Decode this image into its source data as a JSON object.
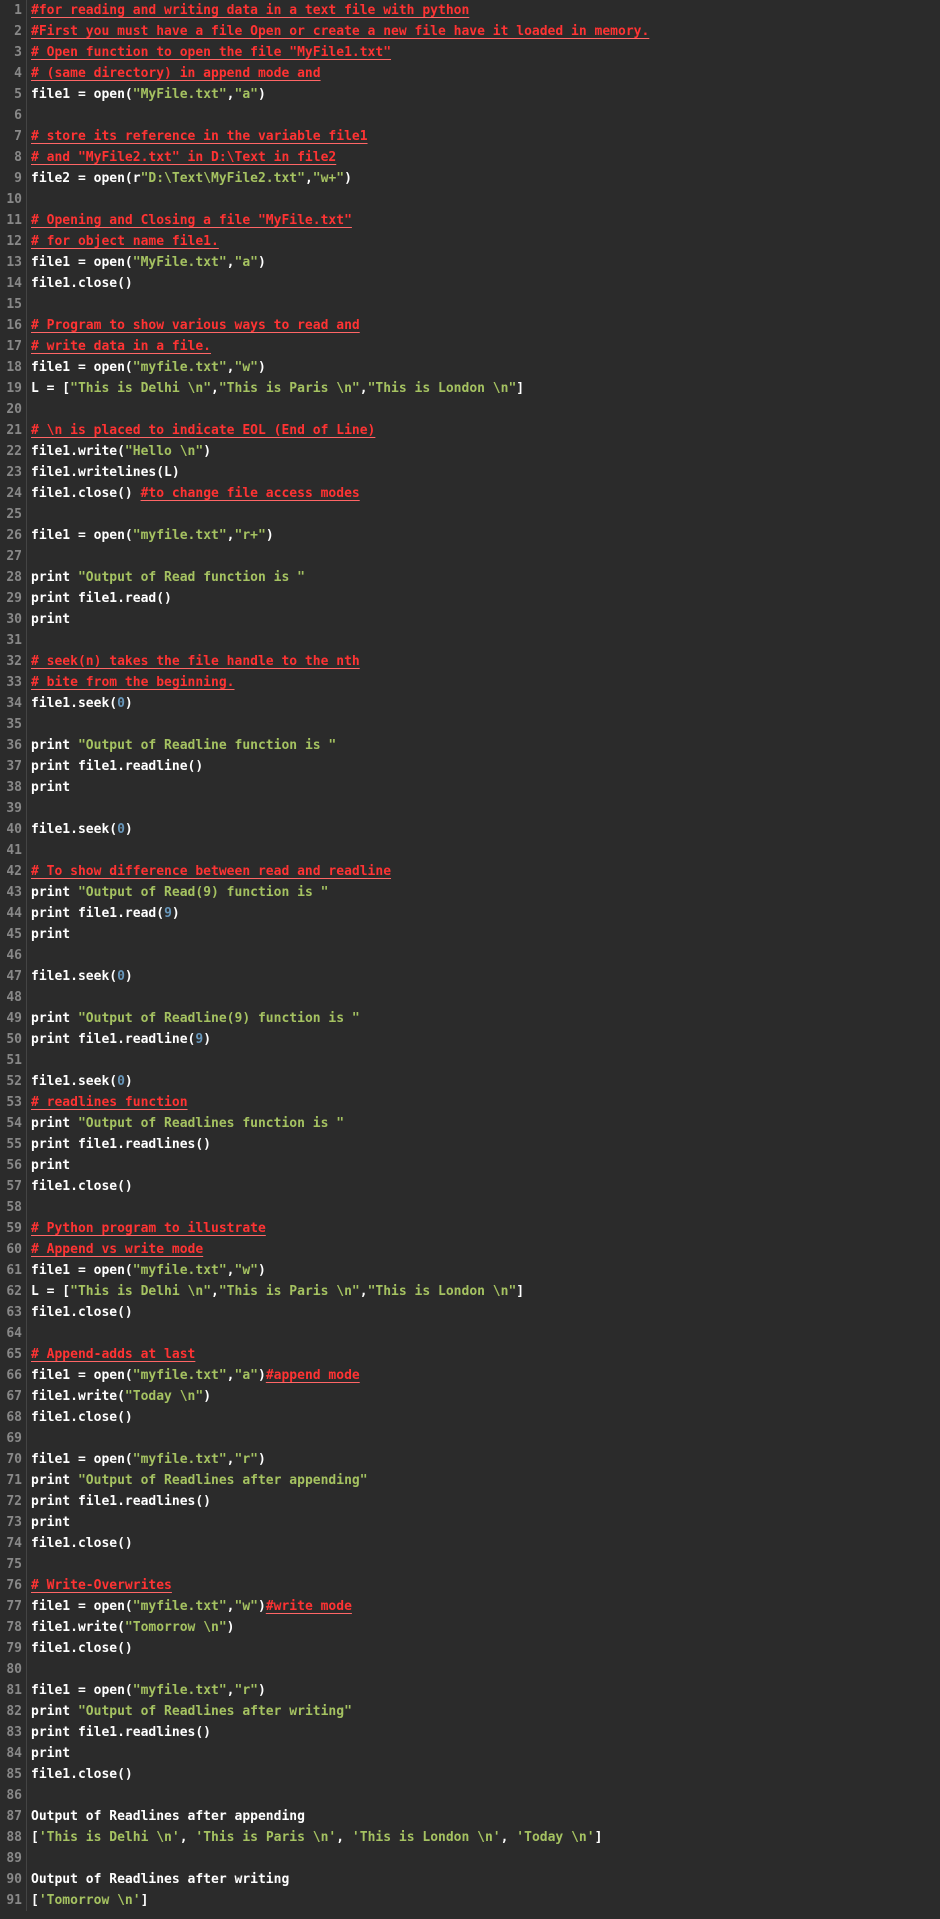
{
  "lines": [
    [
      {
        "t": "#for reading and writing data in a text file with python",
        "cls": "c u"
      }
    ],
    [
      {
        "t": "#First you must have a file Open or create a new file have it loaded in memory.",
        "cls": "c u"
      }
    ],
    [
      {
        "t": "# Open function to open the file \"MyFile1.txt\"",
        "cls": "c u"
      }
    ],
    [
      {
        "t": "# (same directory) in append mode and",
        "cls": "c u"
      }
    ],
    [
      {
        "t": "file1 = open(",
        "cls": "fn"
      },
      {
        "t": "\"MyFile.txt\"",
        "cls": "s"
      },
      {
        "t": ",",
        "cls": "fn"
      },
      {
        "t": "\"a\"",
        "cls": "s"
      },
      {
        "t": ")",
        "cls": "fn"
      }
    ],
    [],
    [
      {
        "t": "# store its reference in the variable file1",
        "cls": "c u"
      }
    ],
    [
      {
        "t": "# and \"MyFile2.txt\" in D:\\Text in file2",
        "cls": "c u"
      }
    ],
    [
      {
        "t": "file2 = open(r",
        "cls": "fn"
      },
      {
        "t": "\"D:\\Text\\MyFile2.txt\"",
        "cls": "s"
      },
      {
        "t": ",",
        "cls": "fn"
      },
      {
        "t": "\"w+\"",
        "cls": "s"
      },
      {
        "t": ")",
        "cls": "fn"
      }
    ],
    [],
    [
      {
        "t": "# Opening and Closing a file \"MyFile.txt\"",
        "cls": "c u"
      }
    ],
    [
      {
        "t": "# for object name file1.",
        "cls": "c u"
      }
    ],
    [
      {
        "t": "file1 = open(",
        "cls": "fn"
      },
      {
        "t": "\"MyFile.txt\"",
        "cls": "s"
      },
      {
        "t": ",",
        "cls": "fn"
      },
      {
        "t": "\"a\"",
        "cls": "s"
      },
      {
        "t": ")",
        "cls": "fn"
      }
    ],
    [
      {
        "t": "file1.close()",
        "cls": "fn"
      }
    ],
    [],
    [
      {
        "t": "# Program to show various ways to read and",
        "cls": "c u"
      }
    ],
    [
      {
        "t": "# write data in a file.",
        "cls": "c u"
      }
    ],
    [
      {
        "t": "file1 = open(",
        "cls": "fn"
      },
      {
        "t": "\"myfile.txt\"",
        "cls": "s"
      },
      {
        "t": ",",
        "cls": "fn"
      },
      {
        "t": "\"w\"",
        "cls": "s"
      },
      {
        "t": ")",
        "cls": "fn"
      }
    ],
    [
      {
        "t": "L = [",
        "cls": "fn"
      },
      {
        "t": "\"This is Delhi \\n\"",
        "cls": "s"
      },
      {
        "t": ",",
        "cls": "fn"
      },
      {
        "t": "\"This is Paris \\n\"",
        "cls": "s"
      },
      {
        "t": ",",
        "cls": "fn"
      },
      {
        "t": "\"This is London \\n\"",
        "cls": "s"
      },
      {
        "t": "]",
        "cls": "fn"
      }
    ],
    [],
    [
      {
        "t": "# \\n is placed to indicate EOL (End of Line)",
        "cls": "c u"
      }
    ],
    [
      {
        "t": "file1.write(",
        "cls": "fn"
      },
      {
        "t": "\"Hello \\n\"",
        "cls": "s"
      },
      {
        "t": ")",
        "cls": "fn"
      }
    ],
    [
      {
        "t": "file1.writelines(L)",
        "cls": "fn"
      }
    ],
    [
      {
        "t": "file1.close() ",
        "cls": "fn"
      },
      {
        "t": "#to change file access modes",
        "cls": "c u"
      }
    ],
    [],
    [
      {
        "t": "file1 = open(",
        "cls": "fn"
      },
      {
        "t": "\"myfile.txt\"",
        "cls": "s"
      },
      {
        "t": ",",
        "cls": "fn"
      },
      {
        "t": "\"r+\"",
        "cls": "s"
      },
      {
        "t": ")",
        "cls": "fn"
      }
    ],
    [],
    [
      {
        "t": "print ",
        "cls": "fn"
      },
      {
        "t": "\"Output of Read function is \"",
        "cls": "s"
      }
    ],
    [
      {
        "t": "print file1.read()",
        "cls": "fn"
      }
    ],
    [
      {
        "t": "print",
        "cls": "fn"
      }
    ],
    [],
    [
      {
        "t": "# seek(n) takes the file handle to the nth",
        "cls": "c u"
      }
    ],
    [
      {
        "t": "# bite from the beginning.",
        "cls": "c u"
      }
    ],
    [
      {
        "t": "file1.seek(",
        "cls": "fn"
      },
      {
        "t": "0",
        "cls": "n"
      },
      {
        "t": ")",
        "cls": "fn"
      }
    ],
    [],
    [
      {
        "t": "print ",
        "cls": "fn"
      },
      {
        "t": "\"Output of Readline function is \"",
        "cls": "s"
      }
    ],
    [
      {
        "t": "print file1.readline()",
        "cls": "fn"
      }
    ],
    [
      {
        "t": "print",
        "cls": "fn"
      }
    ],
    [],
    [
      {
        "t": "file1.seek(",
        "cls": "fn"
      },
      {
        "t": "0",
        "cls": "n"
      },
      {
        "t": ")",
        "cls": "fn"
      }
    ],
    [],
    [
      {
        "t": "# To show difference between read and readline",
        "cls": "c u"
      }
    ],
    [
      {
        "t": "print ",
        "cls": "fn"
      },
      {
        "t": "\"Output of Read(9) function is \"",
        "cls": "s"
      }
    ],
    [
      {
        "t": "print file1.read(",
        "cls": "fn"
      },
      {
        "t": "9",
        "cls": "n"
      },
      {
        "t": ")",
        "cls": "fn"
      }
    ],
    [
      {
        "t": "print",
        "cls": "fn"
      }
    ],
    [],
    [
      {
        "t": "file1.seek(",
        "cls": "fn"
      },
      {
        "t": "0",
        "cls": "n"
      },
      {
        "t": ")",
        "cls": "fn"
      }
    ],
    [],
    [
      {
        "t": "print ",
        "cls": "fn"
      },
      {
        "t": "\"Output of Readline(9) function is \"",
        "cls": "s"
      }
    ],
    [
      {
        "t": "print file1.readline(",
        "cls": "fn"
      },
      {
        "t": "9",
        "cls": "n"
      },
      {
        "t": ")",
        "cls": "fn"
      }
    ],
    [],
    [
      {
        "t": "file1.seek(",
        "cls": "fn"
      },
      {
        "t": "0",
        "cls": "n"
      },
      {
        "t": ")",
        "cls": "fn"
      }
    ],
    [
      {
        "t": "# readlines function",
        "cls": "c u"
      }
    ],
    [
      {
        "t": "print ",
        "cls": "fn"
      },
      {
        "t": "\"Output of Readlines function is \"",
        "cls": "s"
      }
    ],
    [
      {
        "t": "print file1.readlines()",
        "cls": "fn"
      }
    ],
    [
      {
        "t": "print",
        "cls": "fn"
      }
    ],
    [
      {
        "t": "file1.close()",
        "cls": "fn"
      }
    ],
    [],
    [
      {
        "t": "# Python program to illustrate",
        "cls": "c u"
      }
    ],
    [
      {
        "t": "# Append vs write mode",
        "cls": "c u"
      }
    ],
    [
      {
        "t": "file1 = open(",
        "cls": "fn"
      },
      {
        "t": "\"myfile.txt\"",
        "cls": "s"
      },
      {
        "t": ",",
        "cls": "fn"
      },
      {
        "t": "\"w\"",
        "cls": "s"
      },
      {
        "t": ")",
        "cls": "fn"
      }
    ],
    [
      {
        "t": "L = [",
        "cls": "fn"
      },
      {
        "t": "\"This is Delhi \\n\"",
        "cls": "s"
      },
      {
        "t": ",",
        "cls": "fn"
      },
      {
        "t": "\"This is Paris \\n\"",
        "cls": "s"
      },
      {
        "t": ",",
        "cls": "fn"
      },
      {
        "t": "\"This is London \\n\"",
        "cls": "s"
      },
      {
        "t": "]",
        "cls": "fn"
      }
    ],
    [
      {
        "t": "file1.close()",
        "cls": "fn"
      }
    ],
    [],
    [
      {
        "t": "# Append-adds at last",
        "cls": "c u"
      }
    ],
    [
      {
        "t": "file1 = open(",
        "cls": "fn"
      },
      {
        "t": "\"myfile.txt\"",
        "cls": "s"
      },
      {
        "t": ",",
        "cls": "fn"
      },
      {
        "t": "\"a\"",
        "cls": "s"
      },
      {
        "t": ")",
        "cls": "fn"
      },
      {
        "t": "#append mode",
        "cls": "c u"
      }
    ],
    [
      {
        "t": "file1.write(",
        "cls": "fn"
      },
      {
        "t": "\"Today \\n\"",
        "cls": "s"
      },
      {
        "t": ")",
        "cls": "fn"
      }
    ],
    [
      {
        "t": "file1.close()",
        "cls": "fn"
      }
    ],
    [],
    [
      {
        "t": "file1 = open(",
        "cls": "fn"
      },
      {
        "t": "\"myfile.txt\"",
        "cls": "s"
      },
      {
        "t": ",",
        "cls": "fn"
      },
      {
        "t": "\"r\"",
        "cls": "s"
      },
      {
        "t": ")",
        "cls": "fn"
      }
    ],
    [
      {
        "t": "print ",
        "cls": "fn"
      },
      {
        "t": "\"Output of Readlines after appending\"",
        "cls": "s"
      }
    ],
    [
      {
        "t": "print file1.readlines()",
        "cls": "fn"
      }
    ],
    [
      {
        "t": "print",
        "cls": "fn"
      }
    ],
    [
      {
        "t": "file1.close()",
        "cls": "fn"
      }
    ],
    [],
    [
      {
        "t": "# Write-Overwrites",
        "cls": "c u"
      }
    ],
    [
      {
        "t": "file1 = open(",
        "cls": "fn"
      },
      {
        "t": "\"myfile.txt\"",
        "cls": "s"
      },
      {
        "t": ",",
        "cls": "fn"
      },
      {
        "t": "\"w\"",
        "cls": "s"
      },
      {
        "t": ")",
        "cls": "fn"
      },
      {
        "t": "#write mode",
        "cls": "c u"
      }
    ],
    [
      {
        "t": "file1.write(",
        "cls": "fn"
      },
      {
        "t": "\"Tomorrow \\n\"",
        "cls": "s"
      },
      {
        "t": ")",
        "cls": "fn"
      }
    ],
    [
      {
        "t": "file1.close()",
        "cls": "fn"
      }
    ],
    [],
    [
      {
        "t": "file1 = open(",
        "cls": "fn"
      },
      {
        "t": "\"myfile.txt\"",
        "cls": "s"
      },
      {
        "t": ",",
        "cls": "fn"
      },
      {
        "t": "\"r\"",
        "cls": "s"
      },
      {
        "t": ")",
        "cls": "fn"
      }
    ],
    [
      {
        "t": "print ",
        "cls": "fn"
      },
      {
        "t": "\"Output of Readlines after writing\"",
        "cls": "s"
      }
    ],
    [
      {
        "t": "print file1.readlines()",
        "cls": "fn"
      }
    ],
    [
      {
        "t": "print",
        "cls": "fn"
      }
    ],
    [
      {
        "t": "file1.close()",
        "cls": "fn"
      }
    ],
    [],
    [
      {
        "t": "Output of Readlines after appending",
        "cls": "fn"
      }
    ],
    [
      {
        "t": "[",
        "cls": "fn"
      },
      {
        "t": "'This is Delhi \\n'",
        "cls": "s"
      },
      {
        "t": ", ",
        "cls": "fn"
      },
      {
        "t": "'This is Paris \\n'",
        "cls": "s"
      },
      {
        "t": ", ",
        "cls": "fn"
      },
      {
        "t": "'This is London \\n'",
        "cls": "s"
      },
      {
        "t": ", ",
        "cls": "fn"
      },
      {
        "t": "'Today \\n'",
        "cls": "s"
      },
      {
        "t": "]",
        "cls": "fn"
      }
    ],
    [],
    [
      {
        "t": "Output of Readlines after writing",
        "cls": "fn"
      }
    ],
    [
      {
        "t": "[",
        "cls": "fn"
      },
      {
        "t": "'Tomorrow \\n'",
        "cls": "s"
      },
      {
        "t": "]",
        "cls": "fn"
      }
    ]
  ]
}
